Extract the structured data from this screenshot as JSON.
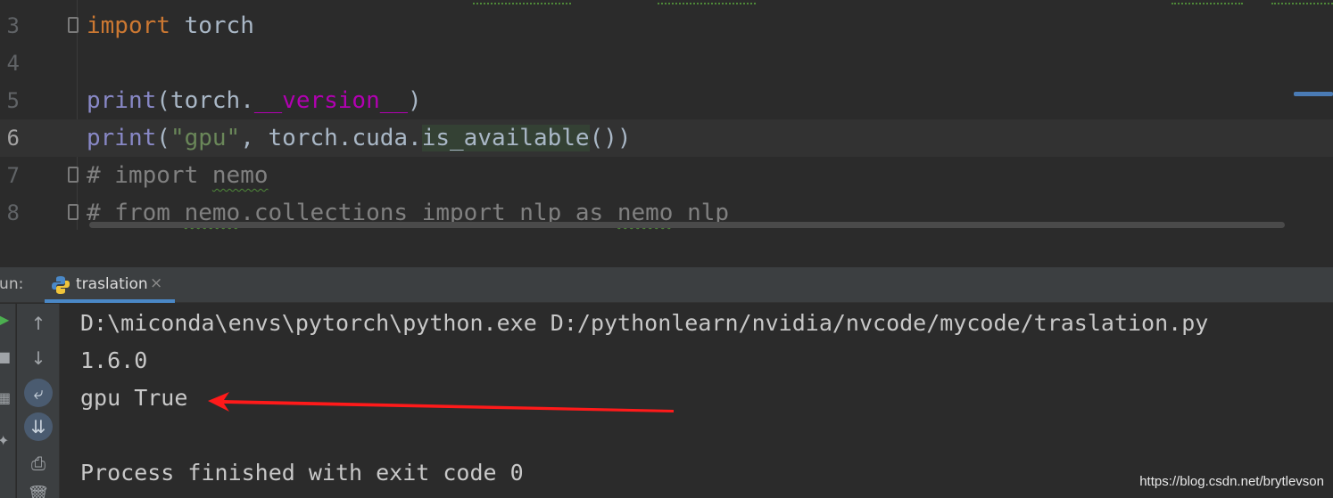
{
  "editor": {
    "lines": [
      {
        "number": "3",
        "tokens": [
          {
            "t": "import",
            "c": "kw"
          },
          {
            "t": " torch",
            "c": ""
          }
        ]
      },
      {
        "number": "4",
        "tokens": []
      },
      {
        "number": "5",
        "tokens": [
          {
            "t": "print",
            "c": "fn"
          },
          {
            "t": "(torch.",
            "c": ""
          },
          {
            "t": "__version__",
            "c": "dunder"
          },
          {
            "t": ")",
            "c": ""
          }
        ]
      },
      {
        "number": "6",
        "tokens": [
          {
            "t": "print",
            "c": "fn"
          },
          {
            "t": "(",
            "c": ""
          },
          {
            "t": "\"gpu\"",
            "c": "str"
          },
          {
            "t": ", torch.cuda.",
            "c": ""
          },
          {
            "t": "is_available",
            "c": "hl"
          },
          {
            "t": "())",
            "c": ""
          }
        ]
      },
      {
        "number": "7",
        "tokens": [
          {
            "t": "# import ",
            "c": "cmt"
          },
          {
            "t": "nemo",
            "c": "cmt squig"
          }
        ]
      },
      {
        "number": "8",
        "tokens": [
          {
            "t": "# from ",
            "c": "cmt"
          },
          {
            "t": "nemo",
            "c": "cmt squig"
          },
          {
            "t": ".collections import nlp as ",
            "c": "cmt"
          },
          {
            "t": "nemo",
            "c": "cmt squig"
          },
          {
            "t": "_nlp",
            "c": "cmt"
          }
        ]
      }
    ],
    "current_line": "6"
  },
  "run_panel": {
    "label": "Run:",
    "tab": {
      "name": "traslation",
      "close": "×",
      "icon": "python-icon"
    },
    "console": [
      "D:\\miconda\\envs\\pytorch\\python.exe D:/pythonlearn/nvidia/nvcode/mycode/traslation.py",
      "1.6.0",
      "gpu True",
      "",
      "Process finished with exit code 0"
    ],
    "tools": [
      "arrow-up-icon",
      "arrow-down-icon",
      "soft-wrap-icon",
      "scroll-to-end-icon",
      "print-icon",
      "trash-icon"
    ]
  },
  "watermark": "https://blog.csdn.net/brytlevson",
  "colors": {
    "keyword": "#cc7832",
    "builtin": "#8888c6",
    "dunder": "#b200b2",
    "string": "#6a8759",
    "comment": "#808080",
    "annotation_arrow": "#ff1a1a",
    "tab_underline": "#4a88c7"
  }
}
